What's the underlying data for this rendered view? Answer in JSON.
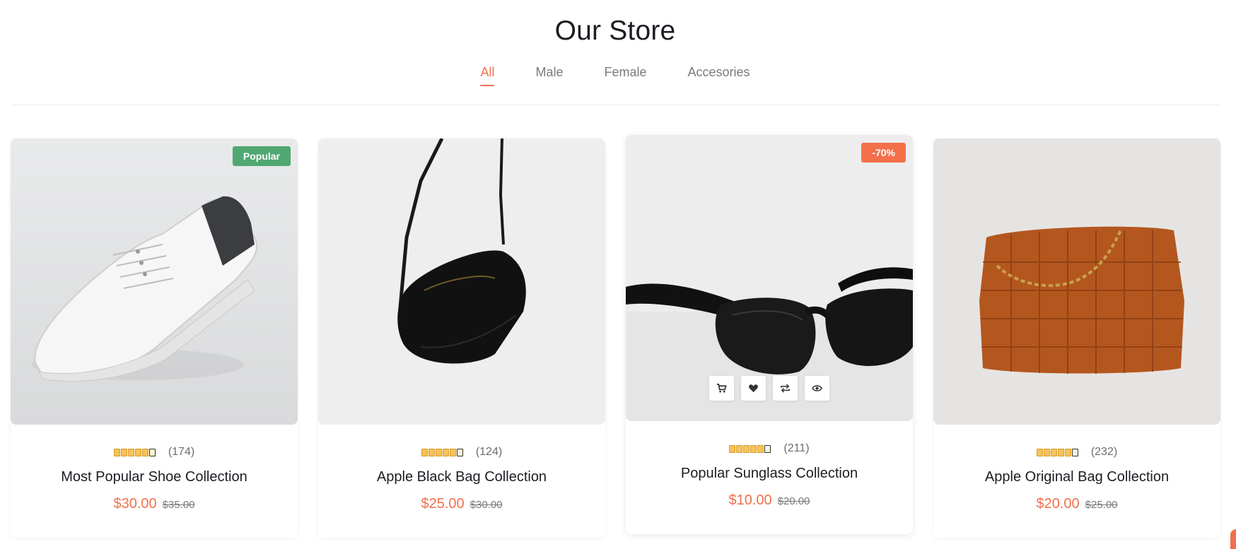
{
  "header": {
    "title": "Our Store"
  },
  "tabs": [
    {
      "label": "All",
      "active": true
    },
    {
      "label": "Male",
      "active": false
    },
    {
      "label": "Female",
      "active": false
    },
    {
      "label": "Accesories",
      "active": false
    }
  ],
  "products": [
    {
      "name": "Most Popular Shoe Collection",
      "reviews": "(174)",
      "price": "$30.00",
      "old_price": "$35.00",
      "badge": "Popular",
      "image": "white-sneaker"
    },
    {
      "name": "Apple Black Bag Collection",
      "reviews": "(124)",
      "price": "$25.00",
      "old_price": "$30.00",
      "badge": "",
      "image": "black-crossbody-bag"
    },
    {
      "name": "Popular Sunglass Collection",
      "reviews": "(211)",
      "price": "$10.00",
      "old_price": "$20.00",
      "badge": "-70%",
      "image": "black-sunglasses"
    },
    {
      "name": "Apple Original Bag Collection",
      "reviews": "(232)",
      "price": "$20.00",
      "old_price": "$25.00",
      "badge": "",
      "image": "brown-woven-bag"
    }
  ],
  "actions": [
    {
      "icon": "cart-icon"
    },
    {
      "icon": "heart-icon"
    },
    {
      "icon": "compare-icon"
    },
    {
      "icon": "eye-icon"
    }
  ],
  "colors": {
    "accent": "#f1704b",
    "badge_popular": "#4fa872",
    "badge_sale": "#f3704b",
    "star": "#f7c35a"
  }
}
